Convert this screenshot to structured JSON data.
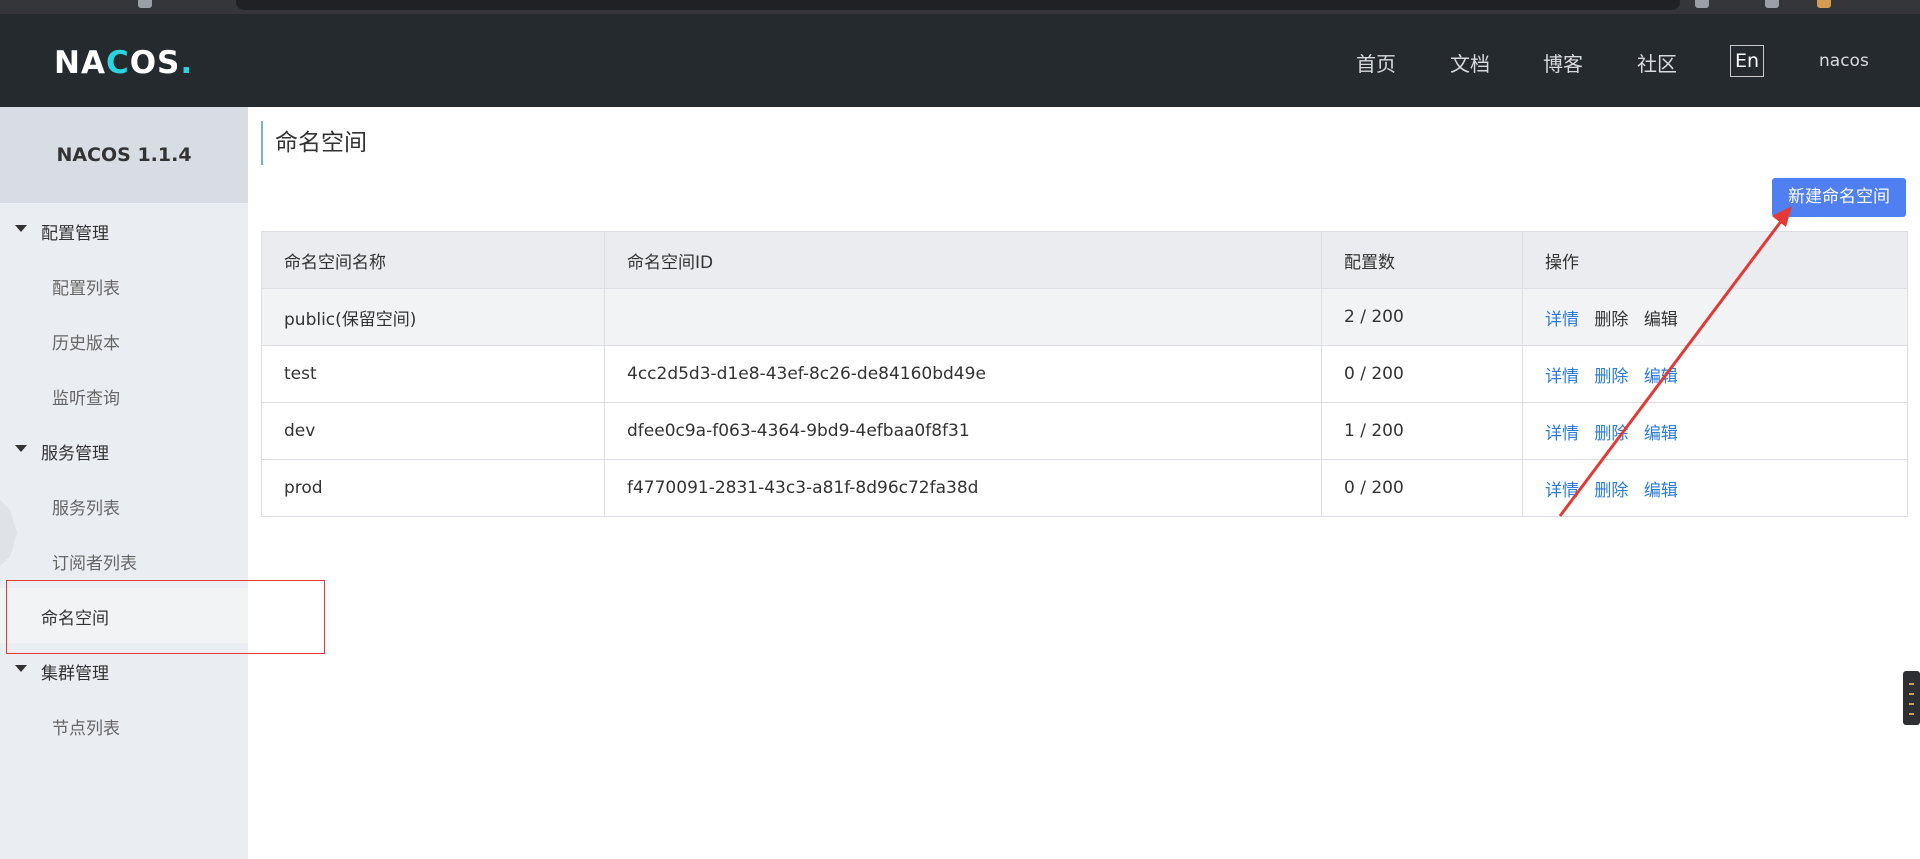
{
  "colors": {
    "header_bg": "#252a2f",
    "accent_blue": "#4f7ff1",
    "link_blue": "#2a7be0",
    "sidebar_bg": "#eaedf1",
    "annotation_red": "#e53935"
  },
  "header": {
    "logo_part1": "NA",
    "logo_part2": "C",
    "logo_part3": "OS",
    "logo_dot": ".",
    "nav": [
      "首页",
      "文档",
      "博客",
      "社区"
    ],
    "lang": "En",
    "user": "nacos"
  },
  "sidebar": {
    "title": "NACOS 1.1.4",
    "groups": [
      {
        "label": "配置管理",
        "items": [
          "配置列表",
          "历史版本",
          "监听查询"
        ]
      },
      {
        "label": "服务管理",
        "items": [
          "服务列表",
          "订阅者列表",
          "命名空间"
        ]
      },
      {
        "label": "集群管理",
        "items": [
          "节点列表"
        ]
      }
    ],
    "active_item": "命名空间"
  },
  "main": {
    "title": "命名空间",
    "create_button": "新建命名空间",
    "table": {
      "headers": [
        "命名空间名称",
        "命名空间ID",
        "配置数",
        "操作"
      ],
      "rows": [
        {
          "name": "public(保留空间)",
          "id": "",
          "count": "2 / 200",
          "actions": [
            "详情",
            "删除",
            "编辑"
          ]
        },
        {
          "name": "test",
          "id": "4cc2d5d3-d1e8-43ef-8c26-de84160bd49e",
          "count": "0 / 200",
          "actions": [
            "详情",
            "删除",
            "编辑"
          ]
        },
        {
          "name": "dev",
          "id": "dfee0c9a-f063-4364-9bd9-4efbaa0f8f31",
          "count": "1 / 200",
          "actions": [
            "详情",
            "删除",
            "编辑"
          ]
        },
        {
          "name": "prod",
          "id": "f4770091-2831-43c3-a81f-8d96c72fa38d",
          "count": "0 / 200",
          "actions": [
            "详情",
            "删除",
            "编辑"
          ]
        }
      ]
    }
  }
}
